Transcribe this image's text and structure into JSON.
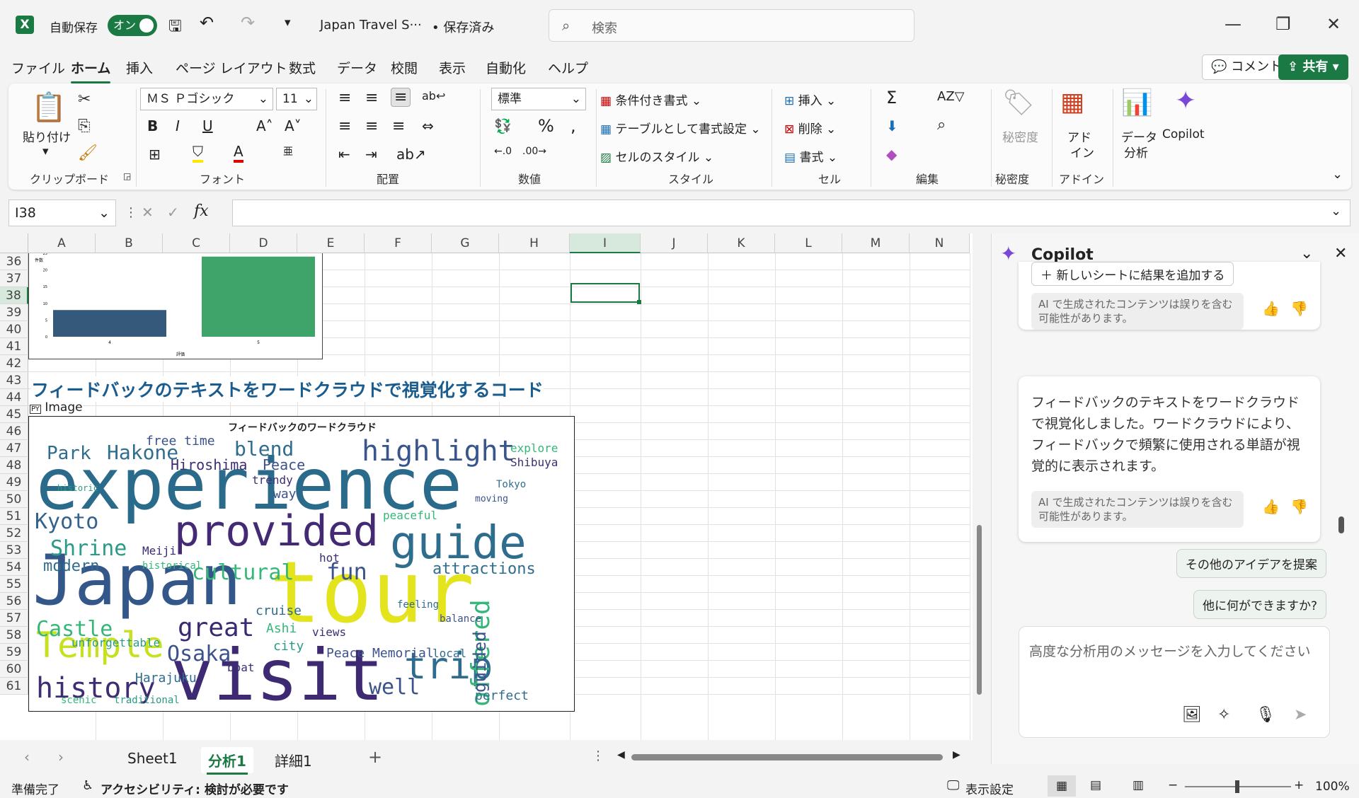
{
  "titlebar": {
    "autosave_label": "自動保存",
    "toggle": "オン",
    "filename": "Japan Travel S···",
    "saved": "• 保存済み",
    "search_placeholder": "検索"
  },
  "menu": [
    "ファイル",
    "ホーム",
    "挿入",
    "ページ レイアウト",
    "数式",
    "データ",
    "校閲",
    "表示",
    "自動化",
    "ヘルプ"
  ],
  "top_buttons": {
    "comment": "コメント",
    "share": "共有"
  },
  "ribbon": {
    "clipboard": {
      "paste": "貼り付け",
      "label": "クリップボード"
    },
    "font": {
      "name": "ＭＳ Ｐゴシック",
      "size": "11",
      "label": "フォント"
    },
    "align": {
      "label": "配置"
    },
    "number": {
      "format": "標準",
      "label": "数値"
    },
    "style": {
      "cond": "条件付き書式",
      "table": "テーブルとして書式設定",
      "cell": "セルのスタイル",
      "label": "スタイル"
    },
    "cells": {
      "insert": "挿入",
      "delete": "削除",
      "format": "書式",
      "label": "セル"
    },
    "edit": {
      "label": "編集"
    },
    "sensitivity": {
      "btn": "秘密度",
      "label": "秘密度"
    },
    "addins": {
      "btn1": "アド",
      "btn2": "イン",
      "label": "アドイン"
    },
    "analysis": {
      "btn1": "データ",
      "btn2": "分析"
    },
    "copilot": {
      "btn": "Copilot"
    }
  },
  "formula": {
    "namebox": "I38",
    "fx": "fx"
  },
  "columns": [
    "A",
    "B",
    "C",
    "D",
    "E",
    "F",
    "G",
    "H",
    "I",
    "J",
    "K",
    "L",
    "M",
    "N"
  ],
  "rows": [
    "36",
    "37",
    "38",
    "39",
    "40",
    "41",
    "42",
    "43",
    "44",
    "45",
    "46",
    "47",
    "48",
    "49",
    "50",
    "51",
    "52",
    "53",
    "54",
    "55",
    "56",
    "57",
    "58",
    "59",
    "60",
    "61"
  ],
  "bar_chart": {
    "xlabel": "評価",
    "ylabel": "件数",
    "x_ticks": [
      "4",
      "5"
    ],
    "y_ticks": [
      "0",
      "5",
      "10",
      "15",
      "20",
      "25"
    ],
    "values": [
      8,
      24
    ]
  },
  "heading": "フィードバックのテキストをワードクラウドで視覚化するコード",
  "py_cell": {
    "badge": "PY",
    "text": "Image"
  },
  "wordcloud": {
    "title": "フィードバックのワードクラウド"
  },
  "tabs": [
    "Sheet1",
    "分析1",
    "詳細1"
  ],
  "status": {
    "ready": "準備完了",
    "access": "アクセシビリティ: 検討が必要です",
    "display": "表示設定",
    "zoom": "100%"
  },
  "copilot": {
    "title": "Copilot",
    "add_sheet": "新しいシートに結果を追加する",
    "ai_note": "AI で生成されたコンテンツは誤りを含む可能性があります。",
    "message": "フィードバックのテキストをワードクラウドで視覚化しました。ワードクラウドにより、フィードバックで頻繁に使用される単語が視覚的に表示されます。",
    "ai_note2": "AI で生成されたコンテンツは誤りを含む可能性があります。",
    "suggest1": "その他のアイデアを提案",
    "suggest2": "他に何ができますか?",
    "input_placeholder": "高度な分析用のメッセージを入力してください"
  }
}
